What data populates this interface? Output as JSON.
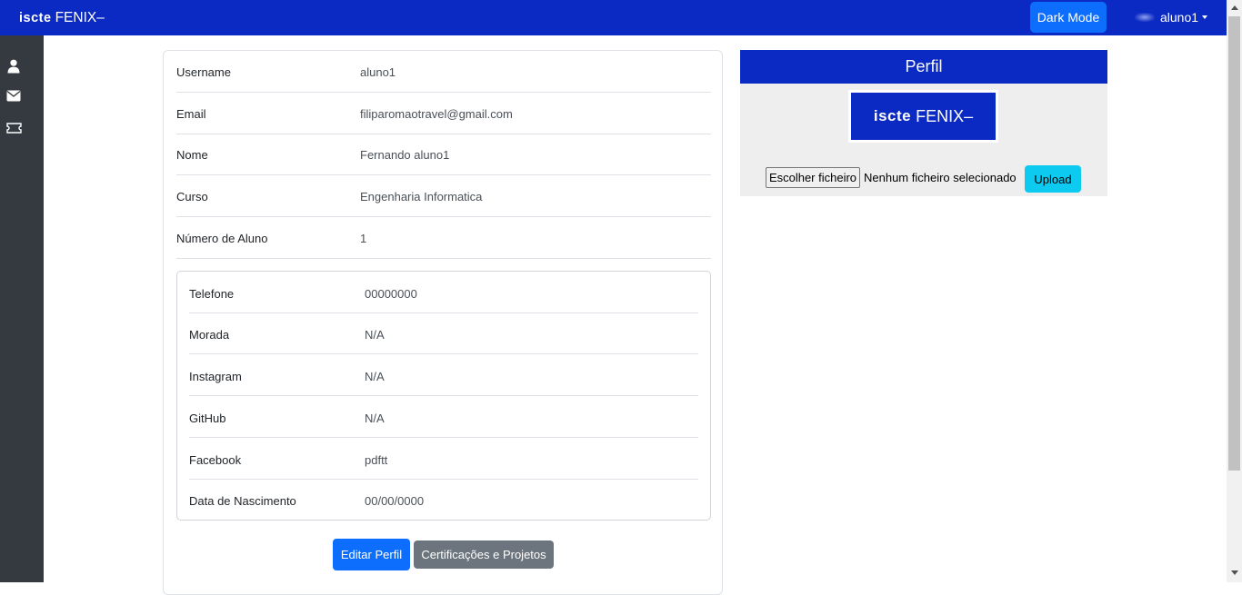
{
  "navbar": {
    "brand_iscte": "iscte",
    "brand_fenix": "FENIX",
    "dark_mode_label": "Dark Mode",
    "username": "aluno1"
  },
  "sidebar": {
    "items": [
      {
        "icon": "user-icon"
      },
      {
        "icon": "envelope-icon"
      },
      {
        "icon": "ticket-icon"
      }
    ]
  },
  "profile": {
    "fields": [
      {
        "label": "Username",
        "value": "aluno1"
      },
      {
        "label": "Email",
        "value": "filiparomaotravel@gmail.com"
      },
      {
        "label": "Nome",
        "value": "Fernando aluno1"
      },
      {
        "label": "Curso",
        "value": "Engenharia Informatica"
      },
      {
        "label": "Número de Aluno",
        "value": "1"
      }
    ],
    "contact_fields": [
      {
        "label": "Telefone",
        "value": "00000000"
      },
      {
        "label": "Morada",
        "value": "N/A"
      },
      {
        "label": "Instagram",
        "value": "N/A"
      },
      {
        "label": "GitHub",
        "value": "N/A"
      },
      {
        "label": "Facebook",
        "value": "pdftt"
      },
      {
        "label": "Data de Nascimento",
        "value": "00/00/0000"
      }
    ],
    "edit_button": "Editar Perfil",
    "cert_button": "Certificações e Projetos"
  },
  "perfil_panel": {
    "title": "Perfil",
    "logo_iscte": "iscte",
    "logo_fenix": "FENIX",
    "choose_file_label": "Escolher ficheiro",
    "no_file_text": "Nenhum ficheiro selecionado",
    "upload_label": "Upload"
  },
  "colors": {
    "primary_blue": "#0b2ac4",
    "button_blue": "#0d6efd",
    "secondary_gray": "#6c757d",
    "info_cyan": "#0dcaf0",
    "sidebar_dark": "#343a40"
  }
}
